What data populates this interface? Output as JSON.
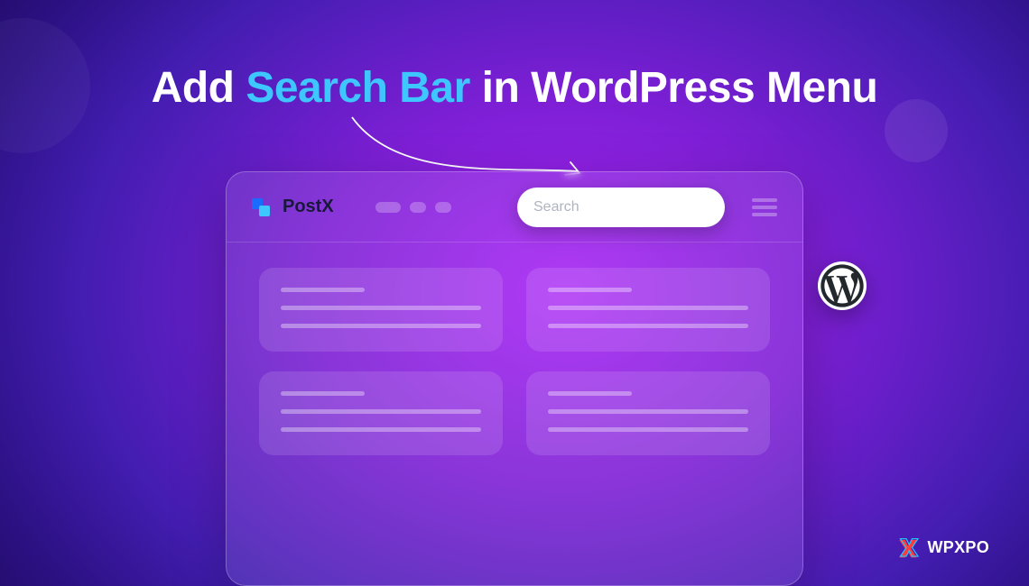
{
  "headline": {
    "prefix": "Add ",
    "accent": "Search Bar",
    "suffix": " in WordPress Menu"
  },
  "browser": {
    "brand": "PostX",
    "search_placeholder": "Search"
  },
  "badge": {
    "icon_name": "wordpress"
  },
  "footer": {
    "brand": "WPXPO"
  }
}
